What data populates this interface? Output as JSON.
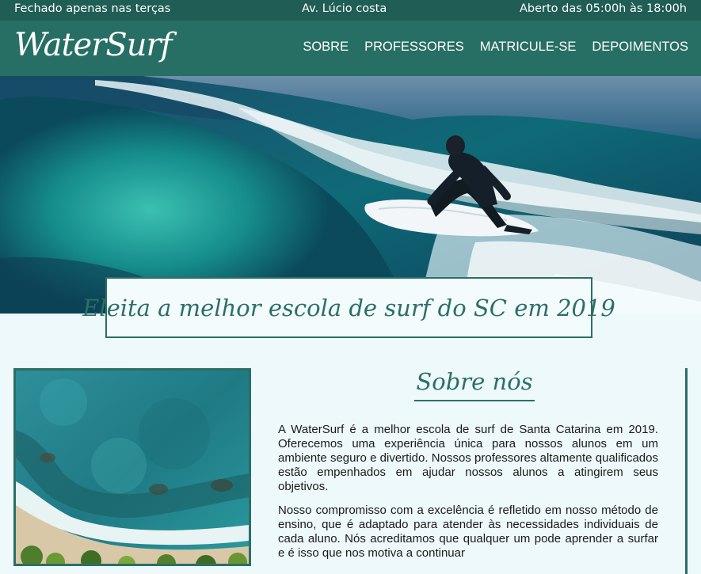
{
  "topbar": {
    "left": "Fechado apenas nas terças",
    "center": "Av. Lúcio costa",
    "right": "Aberto das 05:00h às 18:00h"
  },
  "header": {
    "logo": "WaterSurf",
    "nav": [
      "SOBRE",
      "PROFESSORES",
      "MATRICULE-SE",
      "DEPOIMENTOS"
    ]
  },
  "award": {
    "text": "Eleita a melhor escola de surf do SC em 2019"
  },
  "about": {
    "title": "Sobre nós",
    "paragraphs": [
      "A WaterSurf é a melhor escola de surf de Santa Catarina em 2019. Oferecemos uma experiência única para nossos alunos em um ambiente seguro e divertido. Nossos professores altamente qualificados estão empenhados em ajudar nossos alunos a atingirem seus objetivos.",
      "Nosso compromisso com a excelência é refletido em nosso método de ensino, que é adaptado para atender às necessidades individuais de cada aluno. Nós acreditamos que qualquer um pode aprender a surfar e é isso que nos motiva a continuar"
    ]
  },
  "colors": {
    "topbar": "#1f5d55",
    "header": "#276f64",
    "accent": "#2b6f66",
    "background": "#eef9fb"
  }
}
